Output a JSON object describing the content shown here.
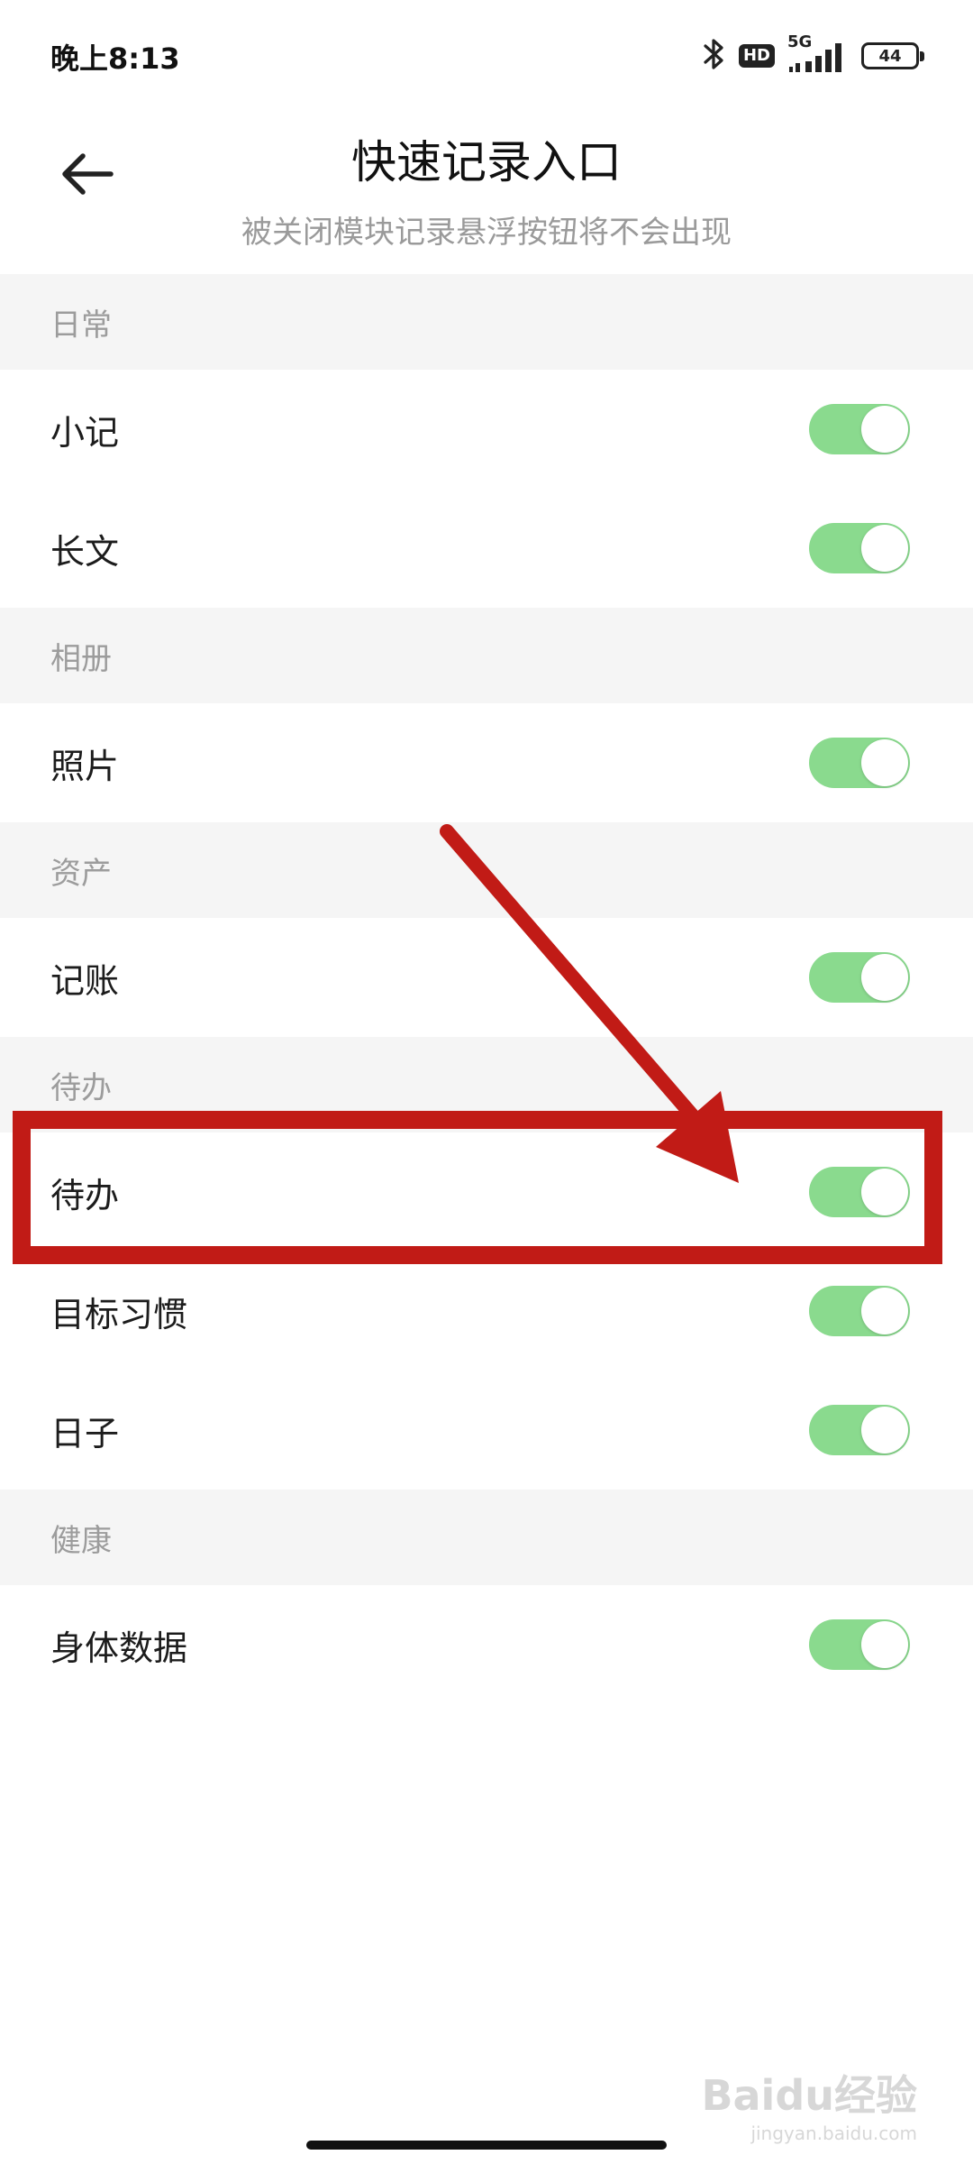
{
  "status_bar": {
    "time": "晚上8:13",
    "hd_label": "HD",
    "network_label": "5G",
    "battery_level": "44",
    "icons": [
      "bluetooth-icon",
      "hd-icon",
      "signal-icon",
      "battery-icon"
    ]
  },
  "header": {
    "title": "快速记录入口",
    "subtitle": "被关闭模块记录悬浮按钮将不会出现",
    "back_icon": "arrow-left-icon"
  },
  "sections": [
    {
      "title": "日常",
      "items": [
        {
          "label": "小记",
          "enabled": true
        },
        {
          "label": "长文",
          "enabled": true
        }
      ]
    },
    {
      "title": "相册",
      "items": [
        {
          "label": "照片",
          "enabled": true
        }
      ]
    },
    {
      "title": "资产",
      "items": [
        {
          "label": "记账",
          "enabled": true
        }
      ]
    },
    {
      "title": "待办",
      "items": [
        {
          "label": "待办",
          "enabled": true
        },
        {
          "label": "目标习惯",
          "enabled": true
        },
        {
          "label": "日子",
          "enabled": true
        }
      ]
    },
    {
      "title": "健康",
      "items": [
        {
          "label": "身体数据",
          "enabled": true
        }
      ]
    }
  ],
  "colors": {
    "toggle_on": "#8ada8e",
    "section_bg": "#f5f5f5",
    "annotation_red": "#c11b16"
  },
  "watermark": {
    "main": "Baidu经验",
    "sub": "jingyan.baidu.com"
  }
}
